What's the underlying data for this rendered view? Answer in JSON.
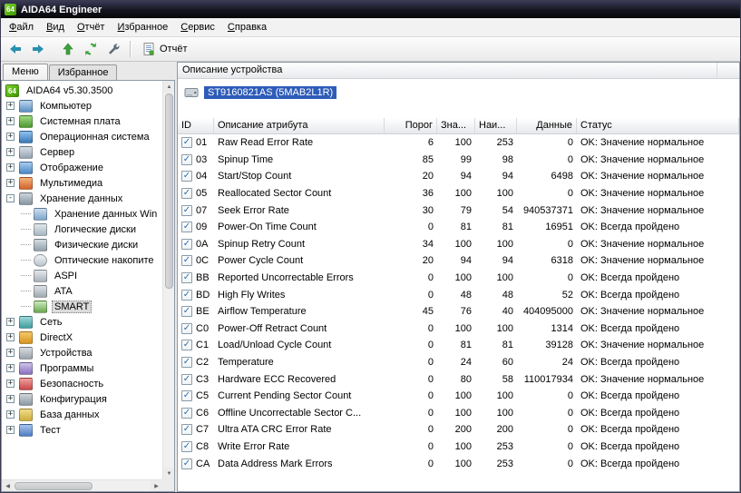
{
  "window": {
    "title": "AIDA64 Engineer",
    "logo_text": "64"
  },
  "menu": {
    "items": [
      "Файл",
      "Вид",
      "Отчёт",
      "Избранное",
      "Сервис",
      "Справка"
    ]
  },
  "toolbar": {
    "report_label": "Отчёт"
  },
  "sidebar": {
    "tabs": [
      {
        "label": "Меню",
        "active": true
      },
      {
        "label": "Избранное",
        "active": false
      }
    ],
    "tree": [
      {
        "label": "AIDA64 v5.30.3500",
        "icon": "aida64-logo",
        "level": 0
      },
      {
        "label": "Компьютер",
        "icon": "computer",
        "level": 1,
        "expander": "+"
      },
      {
        "label": "Системная плата",
        "icon": "motherboard",
        "level": 1,
        "expander": "+"
      },
      {
        "label": "Операционная система",
        "icon": "operating-system",
        "level": 1,
        "expander": "+"
      },
      {
        "label": "Сервер",
        "icon": "server",
        "level": 1,
        "expander": "+"
      },
      {
        "label": "Отображение",
        "icon": "display",
        "level": 1,
        "expander": "+"
      },
      {
        "label": "Мультимедиа",
        "icon": "multimedia",
        "level": 1,
        "expander": "+"
      },
      {
        "label": "Хранение данных",
        "icon": "storage",
        "level": 1,
        "expander": "-"
      },
      {
        "label": "Хранение данных Win",
        "icon": "windows-storage",
        "level": 2
      },
      {
        "label": "Логические диски",
        "icon": "logical-drives",
        "level": 2
      },
      {
        "label": "Физические диски",
        "icon": "physical-drives",
        "level": 2
      },
      {
        "label": "Оптические накопите",
        "icon": "optical-drives",
        "level": 2
      },
      {
        "label": "ASPI",
        "icon": "aspi",
        "level": 2
      },
      {
        "label": "ATA",
        "icon": "ata",
        "level": 2
      },
      {
        "label": "SMART",
        "icon": "smart",
        "level": 2,
        "selected": true
      },
      {
        "label": "Сеть",
        "icon": "network",
        "level": 1,
        "expander": "+"
      },
      {
        "label": "DirectX",
        "icon": "directx",
        "level": 1,
        "expander": "+"
      },
      {
        "label": "Устройства",
        "icon": "devices",
        "level": 1,
        "expander": "+"
      },
      {
        "label": "Программы",
        "icon": "programs",
        "level": 1,
        "expander": "+"
      },
      {
        "label": "Безопасность",
        "icon": "security",
        "level": 1,
        "expander": "+"
      },
      {
        "label": "Конфигурация",
        "icon": "config",
        "level": 1,
        "expander": "+"
      },
      {
        "label": "База данных",
        "icon": "database",
        "level": 1,
        "expander": "+"
      },
      {
        "label": "Тест",
        "icon": "benchmark",
        "level": 1,
        "expander": "+"
      }
    ]
  },
  "device_panel": {
    "header": "Описание устройства",
    "device": "ST9160821AS (5MAB2L1R)"
  },
  "smart_table": {
    "columns": [
      "ID",
      "Описание атрибута",
      "Порог",
      "Зна...",
      "Наи...",
      "Данные",
      "Статус"
    ],
    "rows": [
      {
        "checked": true,
        "id": "01",
        "attribute": "Raw Read Error Rate",
        "threshold": 6,
        "value": 100,
        "worst": 253,
        "data": 0,
        "status": "OK: Значение нормальное"
      },
      {
        "checked": true,
        "id": "03",
        "attribute": "Spinup Time",
        "threshold": 85,
        "value": 99,
        "worst": 98,
        "data": 0,
        "status": "OK: Значение нормальное"
      },
      {
        "checked": true,
        "id": "04",
        "attribute": "Start/Stop Count",
        "threshold": 20,
        "value": 94,
        "worst": 94,
        "data": 6498,
        "status": "OK: Значение нормальное"
      },
      {
        "checked": true,
        "id": "05",
        "attribute": "Reallocated Sector Count",
        "threshold": 36,
        "value": 100,
        "worst": 100,
        "data": 0,
        "status": "OK: Значение нормальное"
      },
      {
        "checked": true,
        "id": "07",
        "attribute": "Seek Error Rate",
        "threshold": 30,
        "value": 79,
        "worst": 54,
        "data": 940537371,
        "status": "OK: Значение нормальное"
      },
      {
        "checked": true,
        "id": "09",
        "attribute": "Power-On Time Count",
        "threshold": 0,
        "value": 81,
        "worst": 81,
        "data": 16951,
        "status": "OK: Всегда пройдено"
      },
      {
        "checked": true,
        "id": "0A",
        "attribute": "Spinup Retry Count",
        "threshold": 34,
        "value": 100,
        "worst": 100,
        "data": 0,
        "status": "OK: Значение нормальное"
      },
      {
        "checked": true,
        "id": "0C",
        "attribute": "Power Cycle Count",
        "threshold": 20,
        "value": 94,
        "worst": 94,
        "data": 6318,
        "status": "OK: Значение нормальное"
      },
      {
        "checked": true,
        "id": "BB",
        "attribute": "Reported Uncorrectable Errors",
        "threshold": 0,
        "value": 100,
        "worst": 100,
        "data": 0,
        "status": "OK: Всегда пройдено"
      },
      {
        "checked": true,
        "id": "BD",
        "attribute": "High Fly Writes",
        "threshold": 0,
        "value": 48,
        "worst": 48,
        "data": 52,
        "status": "OK: Всегда пройдено"
      },
      {
        "checked": true,
        "id": "BE",
        "attribute": "Airflow Temperature",
        "threshold": 45,
        "value": 76,
        "worst": 40,
        "data": 404095000,
        "status": "OK: Значение нормальное"
      },
      {
        "checked": true,
        "id": "C0",
        "attribute": "Power-Off Retract Count",
        "threshold": 0,
        "value": 100,
        "worst": 100,
        "data": 1314,
        "status": "OK: Всегда пройдено"
      },
      {
        "checked": true,
        "id": "C1",
        "attribute": "Load/Unload Cycle Count",
        "threshold": 0,
        "value": 81,
        "worst": 81,
        "data": 39128,
        "status": "OK: Значение нормальное"
      },
      {
        "checked": true,
        "id": "C2",
        "attribute": "Temperature",
        "threshold": 0,
        "value": 24,
        "worst": 60,
        "data": 24,
        "status": "OK: Всегда пройдено"
      },
      {
        "checked": true,
        "id": "C3",
        "attribute": "Hardware ECC Recovered",
        "threshold": 0,
        "value": 80,
        "worst": 58,
        "data": 110017934,
        "status": "OK: Значение нормальное"
      },
      {
        "checked": true,
        "id": "C5",
        "attribute": "Current Pending Sector Count",
        "threshold": 0,
        "value": 100,
        "worst": 100,
        "data": 0,
        "status": "OK: Всегда пройдено"
      },
      {
        "checked": true,
        "id": "C6",
        "attribute": "Offline Uncorrectable Sector C...",
        "threshold": 0,
        "value": 100,
        "worst": 100,
        "data": 0,
        "status": "OK: Всегда пройдено"
      },
      {
        "checked": true,
        "id": "C7",
        "attribute": "Ultra ATA CRC Error Rate",
        "threshold": 0,
        "value": 200,
        "worst": 200,
        "data": 0,
        "status": "OK: Всегда пройдено"
      },
      {
        "checked": true,
        "id": "C8",
        "attribute": "Write Error Rate",
        "threshold": 0,
        "value": 100,
        "worst": 253,
        "data": 0,
        "status": "OK: Всегда пройдено"
      },
      {
        "checked": true,
        "id": "CA",
        "attribute": "Data Address Mark Errors",
        "threshold": 0,
        "value": 100,
        "worst": 253,
        "data": 0,
        "status": "OK: Всегда пройдено"
      }
    ]
  }
}
